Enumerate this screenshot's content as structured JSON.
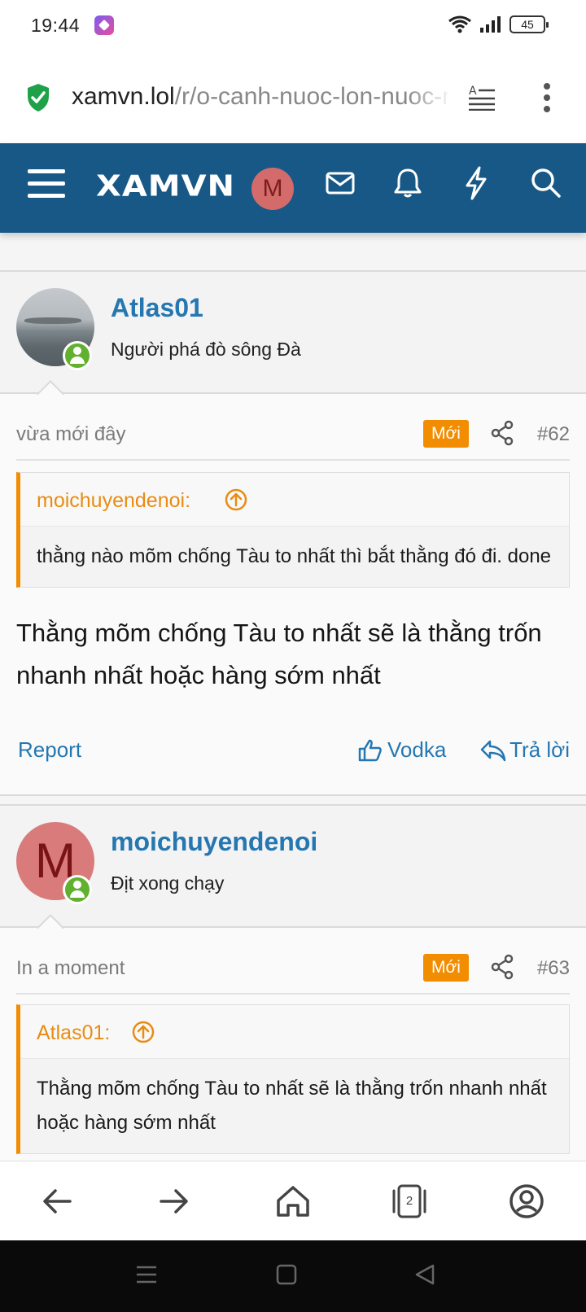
{
  "status_bar": {
    "time": "19:44",
    "battery": "45"
  },
  "browser": {
    "url_domain": "xamvn.lol",
    "url_path": "/r/o-canh-nuoc-lon-nuoc-nho",
    "tab_count": "2"
  },
  "site": {
    "logo": "XAMVN",
    "user_initial": "M"
  },
  "posts": [
    {
      "username": "Atlas01",
      "user_title": "Người phá đò sông Đà",
      "time": "vừa mới đây",
      "badge": "Mới",
      "number": "#62",
      "quote_author": "moichuyendenoi:",
      "quote_text": "thằng nào mõm chống Tàu to nhất thì bắt thằng đó đi. done",
      "text": "Thằng mõm chống Tàu to nhất sẽ là thằng trốn nhanh nhất hoặc hàng sớm nhất",
      "report_label": "Report",
      "like_label": "Vodka",
      "reply_label": "Trả lời"
    },
    {
      "username": "moichuyendenoi",
      "avatar_letter": "M",
      "user_title": "Địt xong chạy",
      "time": "In a moment",
      "badge": "Mới",
      "number": "#63",
      "quote_author": "Atlas01:",
      "quote_text": "Thằng mõm chống Tàu to nhất sẽ là thằng trốn nhanh nhất hoặc hàng sớm nhất"
    }
  ],
  "colors": {
    "header": "#185886",
    "link": "#2577b1",
    "accent": "#f28c00",
    "online": "#62b12e"
  }
}
